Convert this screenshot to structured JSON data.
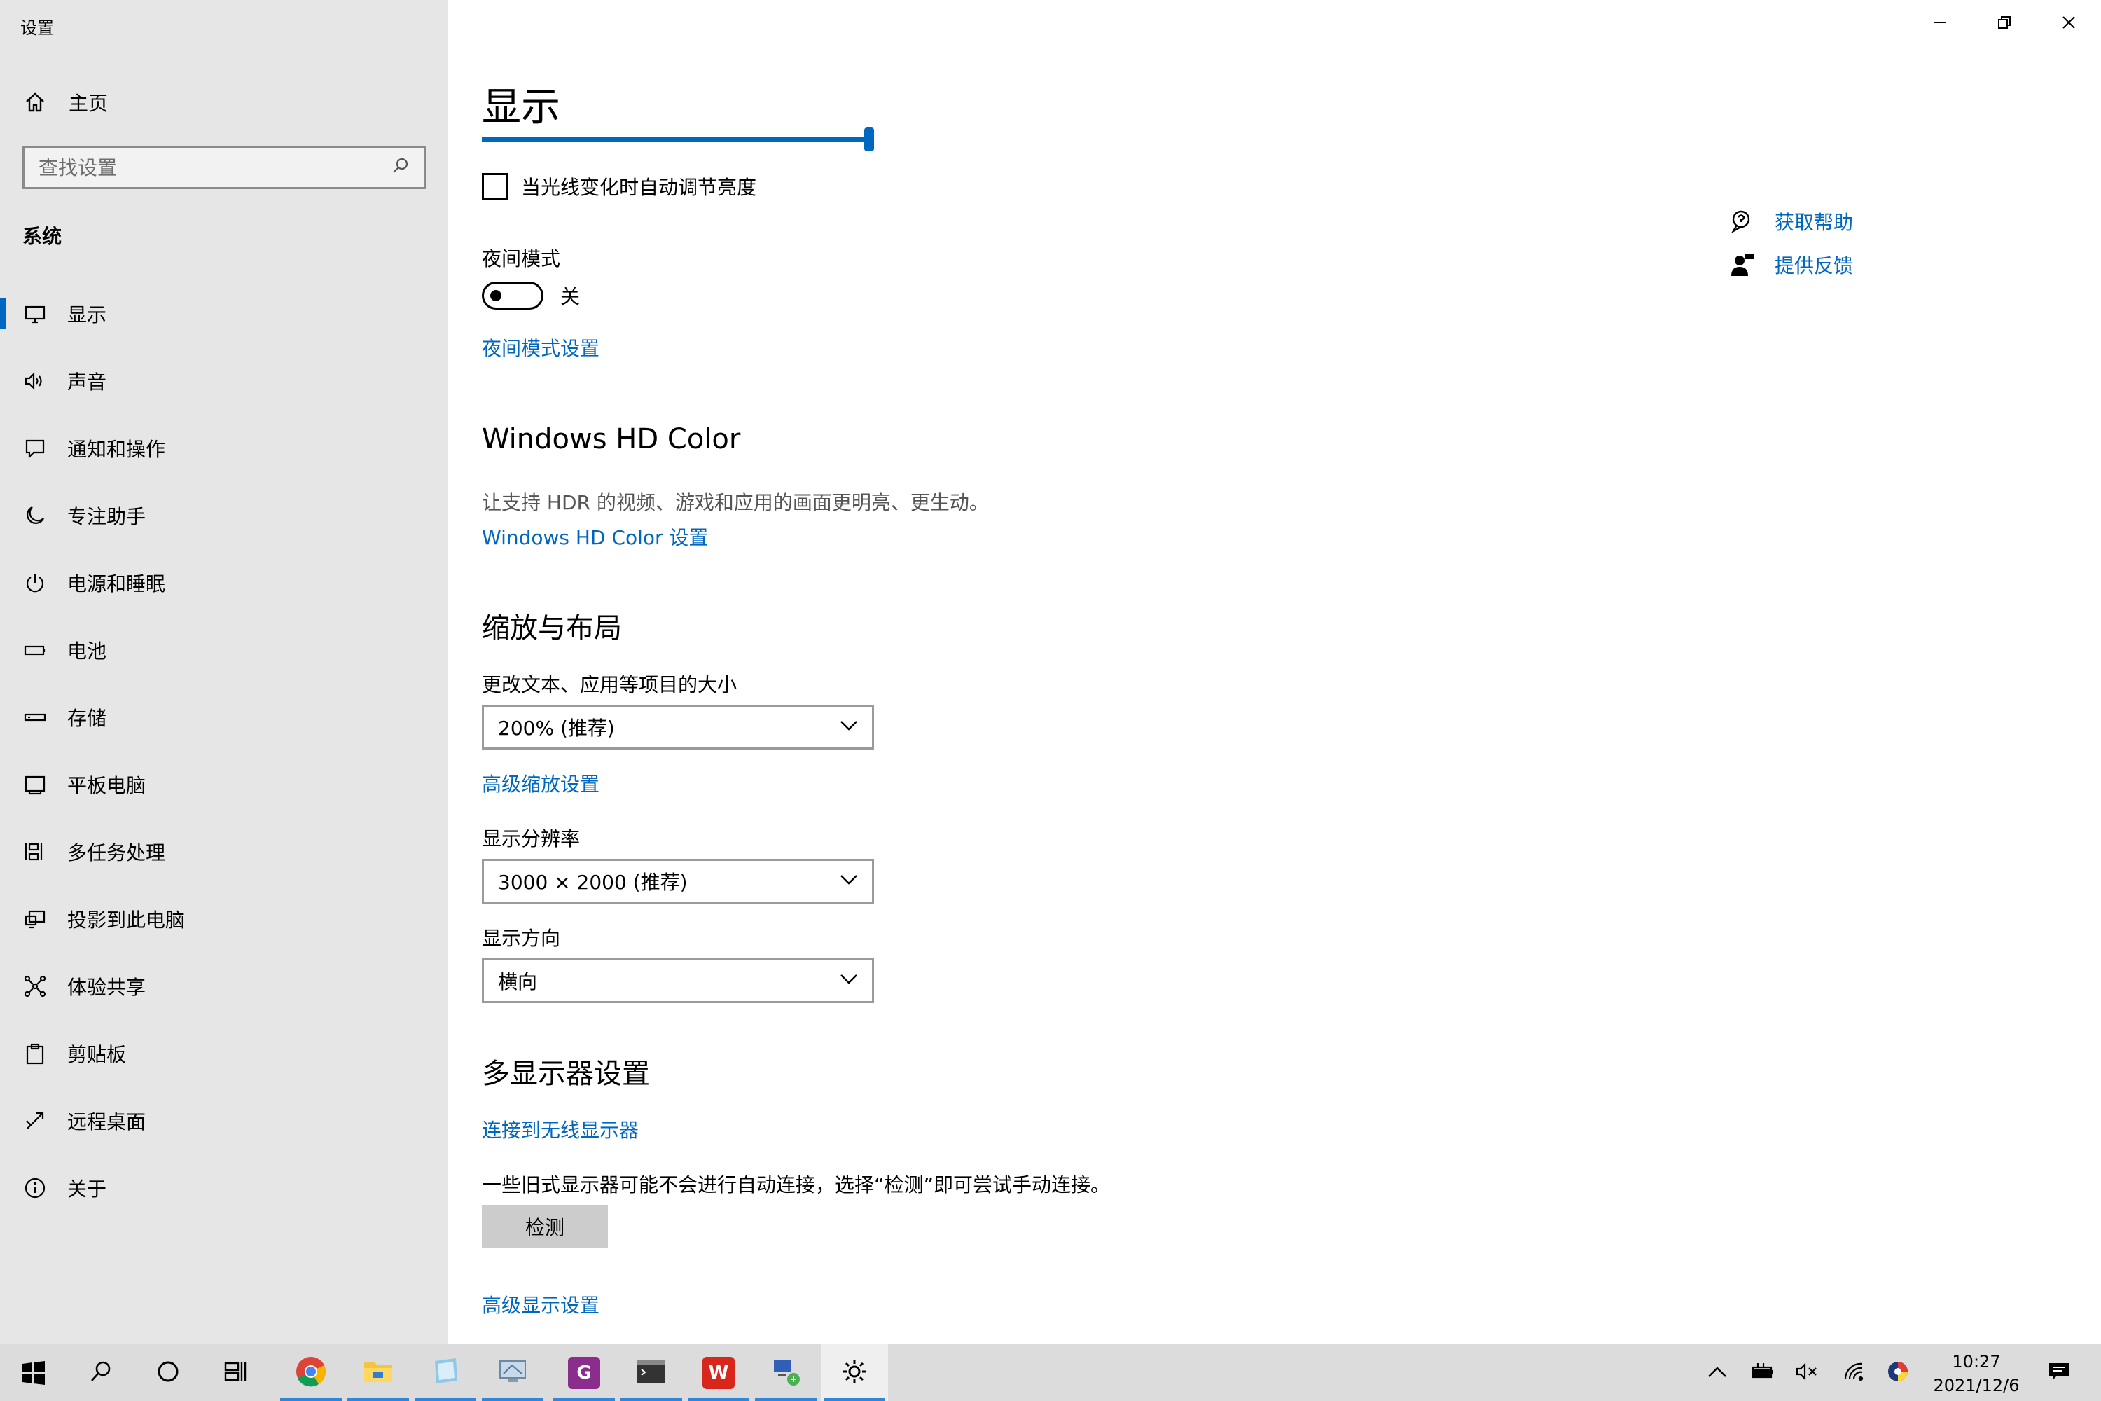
{
  "window": {
    "title": "设置"
  },
  "sidebar": {
    "home_label": "主页",
    "search_placeholder": "查找设置",
    "section": "系统",
    "items": [
      {
        "label": "显示",
        "icon": "monitor-icon",
        "active": true
      },
      {
        "label": "声音",
        "icon": "speaker-icon"
      },
      {
        "label": "通知和操作",
        "icon": "message-icon"
      },
      {
        "label": "专注助手",
        "icon": "moon-icon"
      },
      {
        "label": "电源和睡眠",
        "icon": "power-icon"
      },
      {
        "label": "电池",
        "icon": "battery-icon"
      },
      {
        "label": "存储",
        "icon": "storage-icon"
      },
      {
        "label": "平板电脑",
        "icon": "tablet-icon"
      },
      {
        "label": "多任务处理",
        "icon": "multitask-icon"
      },
      {
        "label": "投影到此电脑",
        "icon": "project-icon"
      },
      {
        "label": "体验共享",
        "icon": "share-icon"
      },
      {
        "label": "剪贴板",
        "icon": "clipboard-icon"
      },
      {
        "label": "远程桌面",
        "icon": "remote-icon"
      },
      {
        "label": "关于",
        "icon": "info-icon"
      }
    ]
  },
  "main": {
    "title": "显示",
    "auto_brightness_label": "当光线变化时自动调节亮度",
    "night_mode": {
      "label": "夜间模式",
      "state": "关",
      "settings_link": "夜间模式设置"
    },
    "hdr": {
      "heading": "Windows HD Color",
      "desc": "让支持 HDR 的视频、游戏和应用的画面更明亮、更生动。",
      "link": "Windows HD Color 设置"
    },
    "scale": {
      "heading": "缩放与布局",
      "size_label": "更改文本、应用等项目的大小",
      "size_value": "200% (推荐)",
      "advanced_link": "高级缩放设置",
      "resolution_label": "显示分辨率",
      "resolution_value": "3000 × 2000 (推荐)",
      "orientation_label": "显示方向",
      "orientation_value": "横向"
    },
    "multi": {
      "heading": "多显示器设置",
      "wireless_link": "连接到无线显示器",
      "note": "一些旧式显示器可能不会进行自动连接，选择“检测”即可尝试手动连接。",
      "detect_button": "检测",
      "advanced_link": "高级显示设置"
    },
    "help": {
      "get_help": "获取帮助",
      "feedback": "提供反馈"
    }
  },
  "taskbar": {
    "time": "10:27",
    "date": "2021/12/6"
  },
  "colors": {
    "accent": "#0067c0",
    "sidebar_bg": "#e6e6e6",
    "taskbar_bg": "#dcdcdc"
  }
}
